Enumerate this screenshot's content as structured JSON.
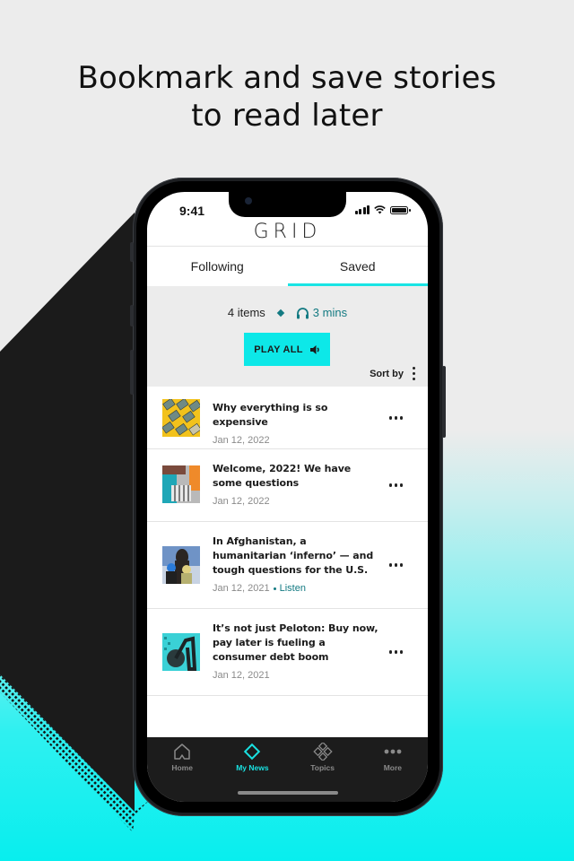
{
  "marketing": {
    "headline_line1": "Bookmark and save stories",
    "headline_line2": "to read later",
    "colors": {
      "cyan": "#08eeee",
      "dark_shape": "#1b1b1b",
      "background": "#ececec"
    }
  },
  "statusbar": {
    "time": "9:41",
    "icons": [
      "signal-icon",
      "wifi-icon",
      "battery-icon"
    ]
  },
  "app": {
    "logo": "GRID",
    "accent_color": "#19e4e4",
    "link_color": "#137a82"
  },
  "tabs": [
    {
      "label": "Following",
      "active": false
    },
    {
      "label": "Saved",
      "active": true
    }
  ],
  "summary": {
    "items_count": "4 items",
    "listen_duration": "3 mins",
    "play_all_label": "PLAY ALL",
    "sort_label": "Sort by"
  },
  "stories": [
    {
      "title": "Why everything is so expensive",
      "date": "Jan 12, 2022",
      "listen": null,
      "thumb": "money-stacks-on-yellow"
    },
    {
      "title": "Welcome, 2022! We have some questions",
      "date": "Jan 12, 2022",
      "listen": null,
      "thumb": "collage-teal-orange"
    },
    {
      "title": "In Afghanistan, a humanitarian ‘inferno’ — and tough questions for the U.S.",
      "date": "Jan 12, 2021",
      "listen": "Listen",
      "thumb": "family-in-snow"
    },
    {
      "title": "It’s not just Peloton: Buy now, pay later is fueling a consumer debt boom",
      "date": "Jan 12, 2021",
      "listen": null,
      "thumb": "exercise-bike-teal"
    }
  ],
  "tabbar": [
    {
      "label": "Home",
      "icon": "home-icon",
      "active": false
    },
    {
      "label": "My News",
      "icon": "diamond-icon",
      "active": true
    },
    {
      "label": "Topics",
      "icon": "topics-icon",
      "active": false
    },
    {
      "label": "More",
      "icon": "more-icon",
      "active": false
    }
  ]
}
